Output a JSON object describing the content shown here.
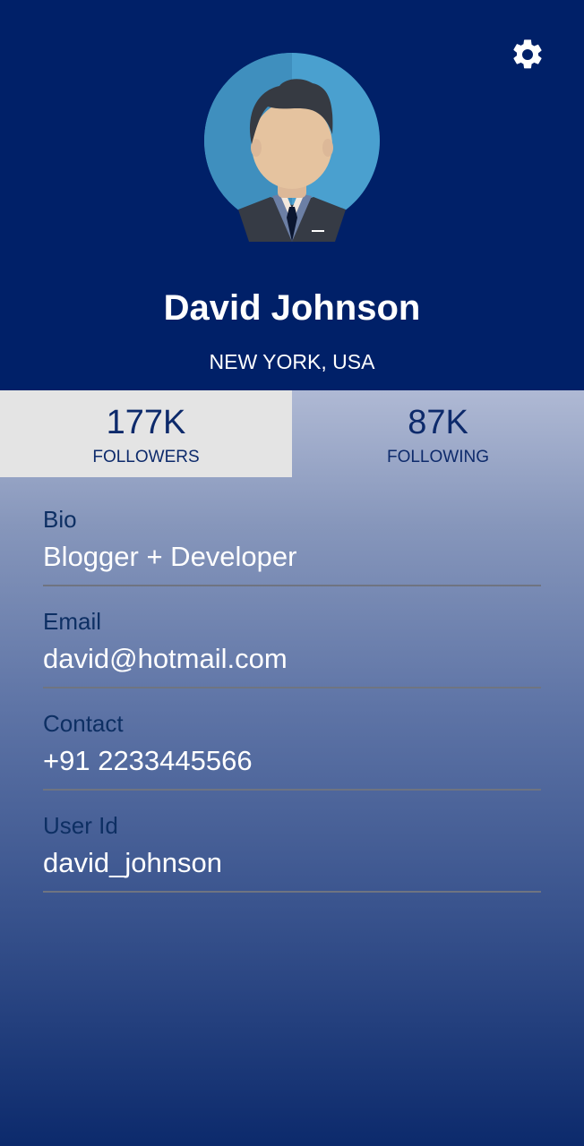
{
  "profile": {
    "name": "David Johnson",
    "location": "NEW YORK, USA"
  },
  "stats": {
    "followers": {
      "value": "177K",
      "label": "FOLLOWERS"
    },
    "following": {
      "value": "87K",
      "label": "FOLLOWING"
    }
  },
  "details": [
    {
      "label": "Bio",
      "value": "Blogger + Developer"
    },
    {
      "label": "Email",
      "value": "david@hotmail.com"
    },
    {
      "label": "Contact",
      "value": "+91 2233445566"
    },
    {
      "label": "User Id",
      "value": "david_johnson"
    }
  ],
  "icons": {
    "settings": "gear-icon",
    "avatar": "avatar-illustration"
  },
  "colors": {
    "header_background": "#002068",
    "stats_selected_background": "#e4e4e4",
    "accent_text": "#0d2a6b",
    "divider": "#6f7481"
  }
}
